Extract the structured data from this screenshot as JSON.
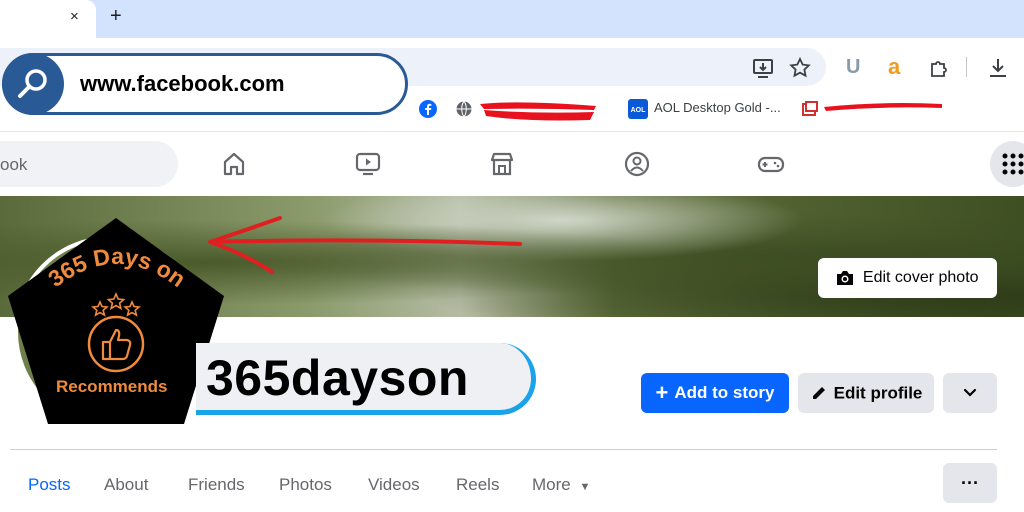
{
  "browser": {
    "tab_close": "×",
    "new_tab": "+",
    "url": "www.facebook.com",
    "toolbar_icons": [
      "install-icon",
      "star-icon",
      "extension-u-icon",
      "amazon-icon",
      "puzzle-icon",
      "download-icon"
    ],
    "bookmarks": [
      {
        "label": "AOL Desktop Gold -..."
      }
    ]
  },
  "facebook": {
    "search_placeholder_visible": "ook",
    "nav_icons": [
      "home-icon",
      "video-icon",
      "marketplace-icon",
      "groups-icon",
      "gaming-icon"
    ],
    "edit_cover_label": "Edit cover photo",
    "profile_name": "365dayson",
    "add_story_label": "Add to story",
    "edit_profile_label": "Edit profile",
    "profile_tabs": [
      "Posts",
      "About",
      "Friends",
      "Photos",
      "Videos",
      "Reels",
      "More"
    ],
    "badge": {
      "top_text": "365 Days on",
      "bottom_text": "Recommends"
    }
  },
  "colors": {
    "accent_blue": "#0866ff",
    "callout_blue": "#2a5a96",
    "badge_orange": "#f08a3c",
    "redaction_red": "#e8121e",
    "arrow_red": "#e02020"
  }
}
